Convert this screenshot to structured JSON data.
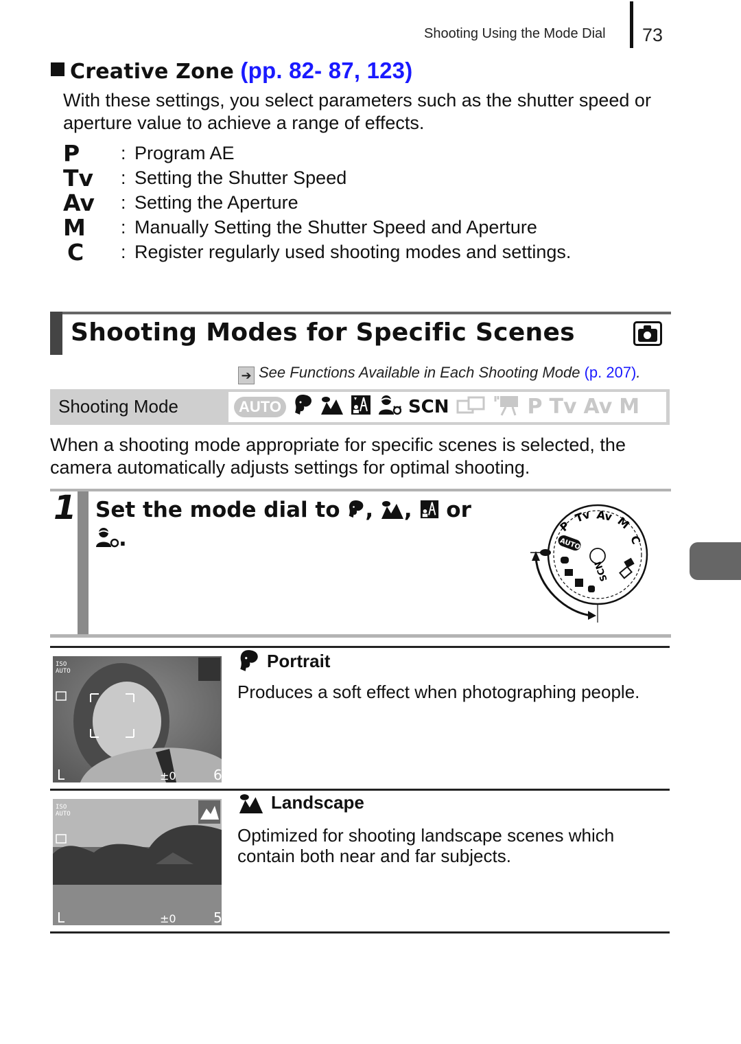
{
  "running_header": {
    "section": "Shooting Using the Mode Dial",
    "page_number": "73"
  },
  "creative_zone": {
    "title": "Creative Zone",
    "page_refs": "(pp. 82- 87, 123)",
    "description": "With these settings, you select parameters such as the shutter speed or aperture value to achieve a range of effects.",
    "modes": [
      {
        "key": "P",
        "label": "Program AE"
      },
      {
        "key": "Tv",
        "label": "Setting the Shutter Speed"
      },
      {
        "key": "Av",
        "label": "Setting the Aperture"
      },
      {
        "key": "M",
        "label": "Manually Setting the Shutter Speed and Aperture"
      },
      {
        "key": "C",
        "label": "Register regularly used shooting modes and settings."
      }
    ]
  },
  "section": {
    "title": "Shooting Modes for Specific Scenes",
    "icon": "camera-icon",
    "see_also_prefix": "See",
    "see_also_text": "Functions Available in Each Shooting Mode",
    "see_also_page": "(p. 207)",
    "see_also_suffix": "."
  },
  "shooting_mode_bar": {
    "label": "Shooting Mode",
    "icons": [
      {
        "name": "auto-icon",
        "text": "AUTO",
        "active": false
      },
      {
        "name": "portrait-icon",
        "text": "",
        "active": true
      },
      {
        "name": "landscape-icon",
        "text": "",
        "active": true
      },
      {
        "name": "night-scene-icon",
        "text": "",
        "active": true
      },
      {
        "name": "kids-pets-icon",
        "text": "",
        "active": true
      },
      {
        "name": "scn-icon",
        "text": "SCN",
        "active": true
      },
      {
        "name": "stitch-assist-icon",
        "text": "",
        "active": false
      },
      {
        "name": "movie-icon",
        "text": "",
        "active": false
      },
      {
        "name": "p-mode-icon",
        "text": "P",
        "active": false
      },
      {
        "name": "tv-mode-icon",
        "text": "Tv",
        "active": false
      },
      {
        "name": "av-mode-icon",
        "text": "Av",
        "active": false
      },
      {
        "name": "m-mode-icon",
        "text": "M",
        "active": false
      }
    ]
  },
  "intro": "When a shooting mode appropriate for specific scenes is selected, the camera automatically adjusts settings for optimal shooting.",
  "step": {
    "number": "1",
    "text_prefix": "Set the mode dial to",
    "sep1": ",",
    "sep2": ",",
    "sep3": "or",
    "end": ".",
    "dial_labels": [
      "P",
      "Tv",
      "Av",
      "M",
      "C",
      "AUTO",
      "SCN"
    ]
  },
  "features": [
    {
      "title": "Portrait",
      "icon": "portrait-icon",
      "description": "Produces a soft effect when photographing people.",
      "screen": {
        "iso": "ISO AUTO",
        "exposure": "±0",
        "shots": "6",
        "size": "L"
      }
    },
    {
      "title": "Landscape",
      "icon": "landscape-icon",
      "description": "Optimized for shooting landscape scenes which contain both near and far subjects.",
      "screen": {
        "iso": "ISO AUTO",
        "exposure": "±0",
        "shots": "5",
        "size": "L"
      }
    }
  ]
}
